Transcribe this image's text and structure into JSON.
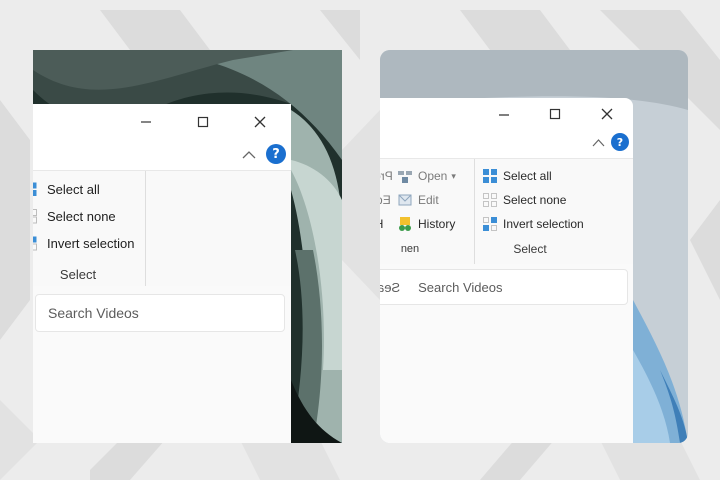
{
  "left": {
    "ribbon": {
      "select_all": "Select all",
      "select_none": "Select none",
      "invert_selection": "Invert selection",
      "group_label": "Select"
    },
    "search": {
      "placeholder": "Search Videos"
    }
  },
  "right": {
    "ribbon": {
      "open_group": {
        "open": "Open",
        "edit": "Edit",
        "history": "History",
        "properties_clipped": "Pro",
        "edit_clipped": "Ed",
        "history_clipped": "Hi",
        "label_clipped": "nen"
      },
      "select_group": {
        "select_all": "Select all",
        "select_none": "Select none",
        "invert_selection": "Invert selection",
        "label": "Select"
      }
    },
    "search": {
      "clipped_text": "Sea",
      "placeholder": "Search Videos"
    }
  },
  "colors": {
    "page_bg": "#ececec",
    "window_bg": "#ffffff",
    "ribbon_bg": "#f9f9f9",
    "accent_blue": "#1a6fcf",
    "select_icon_blue": "#3b8ed6",
    "history_icon_yellow": "#f2c12e",
    "history_icon_green": "#3a9b4a"
  },
  "icons": [
    "minimize-icon",
    "maximize-icon",
    "close-icon",
    "collapse-ribbon-icon",
    "help-icon",
    "select-all-icon",
    "select-none-icon",
    "invert-selection-icon",
    "open-icon",
    "edit-icon",
    "history-icon"
  ]
}
